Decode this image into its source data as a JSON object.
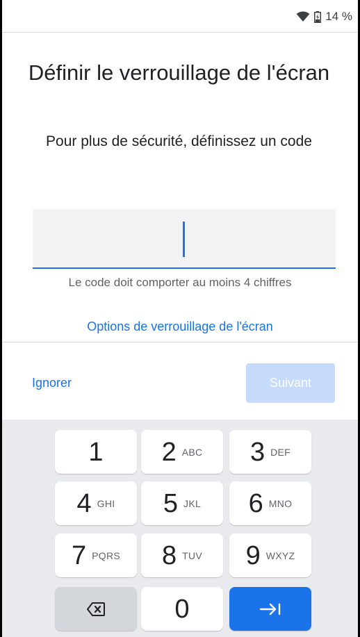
{
  "status_bar": {
    "battery_text": "14 %",
    "wifi_icon": "wifi-icon",
    "battery_icon": "battery-charging-icon"
  },
  "header": {
    "title": "Définir le verrouillage de l'écran",
    "subtitle": "Pour plus de sécurité, définissez un code"
  },
  "pin": {
    "value": "",
    "helper": "Le code doit comporter au moins 4 chiffres"
  },
  "options_link": "Options de verrouillage de l'écran",
  "actions": {
    "skip_label": "Ignorer",
    "next_label": "Suivant",
    "next_enabled": false
  },
  "keypad": {
    "keys": [
      {
        "digit": "1",
        "letters": ""
      },
      {
        "digit": "2",
        "letters": "ABC"
      },
      {
        "digit": "3",
        "letters": "DEF"
      },
      {
        "digit": "4",
        "letters": "GHI"
      },
      {
        "digit": "5",
        "letters": "JKL"
      },
      {
        "digit": "6",
        "letters": "MNO"
      },
      {
        "digit": "7",
        "letters": "PQRS"
      },
      {
        "digit": "8",
        "letters": "TUV"
      },
      {
        "digit": "9",
        "letters": "WXYZ"
      },
      {
        "digit": "0",
        "letters": ""
      }
    ],
    "backspace_icon": "backspace-icon",
    "enter_icon": "tab-enter-icon"
  },
  "colors": {
    "accent": "#1a73e8",
    "disabled_button": "#c6dafc",
    "keyboard_bg": "#e8eaed"
  }
}
